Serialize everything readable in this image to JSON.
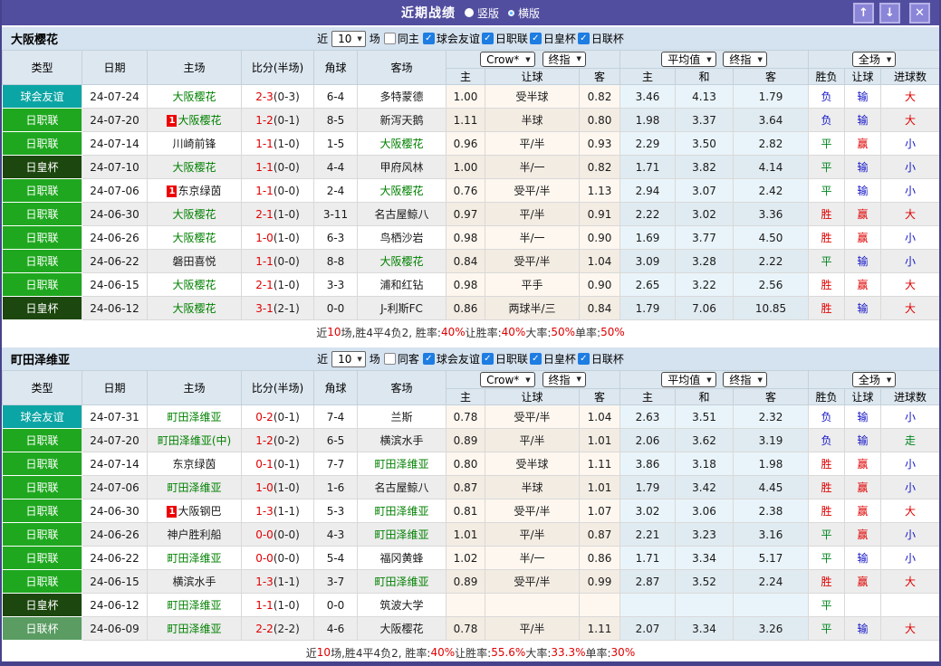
{
  "titlebar": {
    "title": "近期战绩",
    "radio_selected": "竖版",
    "radio_unselected": "横版",
    "up_icon": "↑",
    "down_icon": "↓",
    "close_icon": "✕"
  },
  "colors": {
    "titlebar_purple": "#524e9f",
    "friendly_teal": "#0ca5a5",
    "jleague_green": "#1fa81f",
    "emperor_cup_dark_green": "#1c470e",
    "league_cup_green": "#5a9c62",
    "focus_team_green": "#008000",
    "win_red": "#e00000",
    "draw_green": "#00851f",
    "lose_blue": "#1515c8",
    "checkbox_blue": "#1d7de2"
  },
  "table_header": {
    "col_type": "类型",
    "col_date": "日期",
    "col_home": "主场",
    "col_score": "比分(半场)",
    "col_corner": "角球",
    "col_away": "客场",
    "crow_select": "Crow*",
    "final_select": "终指",
    "avg_select": "平均值",
    "final_select2": "终指",
    "full_select": "全场",
    "sub_home": "主",
    "sub_handicap": "让球",
    "sub_away": "客",
    "sub_draw": "和",
    "sub_wdl": "胜负",
    "sub_handicap2": "让球",
    "sub_goals": "进球数"
  },
  "filter_labels": {
    "near": "近",
    "count": "10",
    "matches": "场"
  },
  "sections": [
    {
      "team": "大阪樱花",
      "same_option": "同主",
      "leagues": [
        "球会友谊",
        "日职联",
        "日皇杯",
        "日联杯"
      ],
      "rows": [
        {
          "type": "球会友谊",
          "type_key": "friendly",
          "date": "24-07-24",
          "home": "大阪樱花",
          "home_focus": true,
          "home_badge": false,
          "score": "2-3",
          "half": "(0-3)",
          "corner": "6-4",
          "away": "多特蒙德",
          "away_focus": false,
          "away_badge": false,
          "crow": [
            "1.00",
            "受半球",
            "0.82"
          ],
          "avg": [
            "3.46",
            "4.13",
            "1.79"
          ],
          "res": [
            "负",
            "输",
            "大"
          ]
        },
        {
          "type": "日职联",
          "type_key": "jleague",
          "date": "24-07-20",
          "home": "大阪樱花",
          "home_focus": true,
          "home_badge": true,
          "score": "1-2",
          "half": "(0-1)",
          "corner": "8-5",
          "away": "新泻天鹅",
          "away_focus": false,
          "away_badge": false,
          "crow": [
            "1.11",
            "半球",
            "0.80"
          ],
          "avg": [
            "1.98",
            "3.37",
            "3.64"
          ],
          "res": [
            "负",
            "输",
            "大"
          ]
        },
        {
          "type": "日职联",
          "type_key": "jleague",
          "date": "24-07-14",
          "home": "川崎前锋",
          "home_focus": false,
          "home_badge": false,
          "score": "1-1",
          "half": "(1-0)",
          "corner": "1-5",
          "away": "大阪樱花",
          "away_focus": true,
          "away_badge": false,
          "crow": [
            "0.96",
            "平/半",
            "0.93"
          ],
          "avg": [
            "2.29",
            "3.50",
            "2.82"
          ],
          "res": [
            "平",
            "赢",
            "小"
          ]
        },
        {
          "type": "日皇杯",
          "type_key": "emperor",
          "date": "24-07-10",
          "home": "大阪樱花",
          "home_focus": true,
          "home_badge": false,
          "score": "1-1",
          "half": "(0-0)",
          "corner": "4-4",
          "away": "甲府风林",
          "away_focus": false,
          "away_badge": false,
          "crow": [
            "1.00",
            "半/一",
            "0.82"
          ],
          "avg": [
            "1.71",
            "3.82",
            "4.14"
          ],
          "res": [
            "平",
            "输",
            "小"
          ]
        },
        {
          "type": "日职联",
          "type_key": "jleague",
          "date": "24-07-06",
          "home": "东京绿茵",
          "home_focus": false,
          "home_badge": true,
          "score": "1-1",
          "half": "(0-0)",
          "corner": "2-4",
          "away": "大阪樱花",
          "away_focus": true,
          "away_badge": false,
          "crow": [
            "0.76",
            "受平/半",
            "1.13"
          ],
          "avg": [
            "2.94",
            "3.07",
            "2.42"
          ],
          "res": [
            "平",
            "输",
            "小"
          ]
        },
        {
          "type": "日职联",
          "type_key": "jleague",
          "date": "24-06-30",
          "home": "大阪樱花",
          "home_focus": true,
          "home_badge": false,
          "score": "2-1",
          "half": "(1-0)",
          "corner": "3-11",
          "away": "名古屋鲸八",
          "away_focus": false,
          "away_badge": false,
          "crow": [
            "0.97",
            "平/半",
            "0.91"
          ],
          "avg": [
            "2.22",
            "3.02",
            "3.36"
          ],
          "res": [
            "胜",
            "赢",
            "大"
          ]
        },
        {
          "type": "日职联",
          "type_key": "jleague",
          "date": "24-06-26",
          "home": "大阪樱花",
          "home_focus": true,
          "home_badge": false,
          "score": "1-0",
          "half": "(1-0)",
          "corner": "6-3",
          "away": "鸟栖沙岩",
          "away_focus": false,
          "away_badge": false,
          "crow": [
            "0.98",
            "半/一",
            "0.90"
          ],
          "avg": [
            "1.69",
            "3.77",
            "4.50"
          ],
          "res": [
            "胜",
            "赢",
            "小"
          ]
        },
        {
          "type": "日职联",
          "type_key": "jleague",
          "date": "24-06-22",
          "home": "磐田喜悦",
          "home_focus": false,
          "home_badge": false,
          "score": "1-1",
          "half": "(0-0)",
          "corner": "8-8",
          "away": "大阪樱花",
          "away_focus": true,
          "away_badge": false,
          "crow": [
            "0.84",
            "受平/半",
            "1.04"
          ],
          "avg": [
            "3.09",
            "3.28",
            "2.22"
          ],
          "res": [
            "平",
            "输",
            "小"
          ]
        },
        {
          "type": "日职联",
          "type_key": "jleague",
          "date": "24-06-15",
          "home": "大阪樱花",
          "home_focus": true,
          "home_badge": false,
          "score": "2-1",
          "half": "(1-0)",
          "corner": "3-3",
          "away": "浦和红钻",
          "away_focus": false,
          "away_badge": false,
          "crow": [
            "0.98",
            "平手",
            "0.90"
          ],
          "avg": [
            "2.65",
            "3.22",
            "2.56"
          ],
          "res": [
            "胜",
            "赢",
            "大"
          ]
        },
        {
          "type": "日皇杯",
          "type_key": "emperor",
          "date": "24-06-12",
          "home": "大阪樱花",
          "home_focus": true,
          "home_badge": false,
          "score": "3-1",
          "half": "(2-1)",
          "corner": "0-0",
          "away": "J-利斯FC",
          "away_focus": false,
          "away_badge": false,
          "crow": [
            "0.86",
            "两球半/三",
            "0.84"
          ],
          "avg": [
            "1.79",
            "7.06",
            "10.85"
          ],
          "res": [
            "胜",
            "输",
            "大"
          ]
        }
      ],
      "summary": [
        {
          "t": "近"
        },
        {
          "t": "10",
          "red": true
        },
        {
          "t": "场,胜4平4负2, 胜率:"
        },
        {
          "t": "40%",
          "red": true
        },
        {
          "t": " 让胜率:"
        },
        {
          "t": "40%",
          "red": true
        },
        {
          "t": " 大率:"
        },
        {
          "t": "50%",
          "red": true
        },
        {
          "t": " 单率:"
        },
        {
          "t": "50%",
          "red": true
        }
      ]
    },
    {
      "team": "町田泽维亚",
      "same_option": "同客",
      "leagues": [
        "球会友谊",
        "日职联",
        "日皇杯",
        "日联杯"
      ],
      "rows": [
        {
          "type": "球会友谊",
          "type_key": "friendly",
          "date": "24-07-31",
          "home": "町田泽维亚",
          "home_focus": true,
          "home_badge": false,
          "score": "0-2",
          "half": "(0-1)",
          "corner": "7-4",
          "away": "兰斯",
          "away_focus": false,
          "away_badge": false,
          "crow": [
            "0.78",
            "受平/半",
            "1.04"
          ],
          "avg": [
            "2.63",
            "3.51",
            "2.32"
          ],
          "res": [
            "负",
            "输",
            "小"
          ]
        },
        {
          "type": "日职联",
          "type_key": "jleague",
          "date": "24-07-20",
          "home": "町田泽维亚(中)",
          "home_focus": true,
          "home_badge": false,
          "score": "1-2",
          "half": "(0-2)",
          "corner": "6-5",
          "away": "横滨水手",
          "away_focus": false,
          "away_badge": false,
          "crow": [
            "0.89",
            "平/半",
            "1.01"
          ],
          "avg": [
            "2.06",
            "3.62",
            "3.19"
          ],
          "res": [
            "负",
            "输",
            "走"
          ]
        },
        {
          "type": "日职联",
          "type_key": "jleague",
          "date": "24-07-14",
          "home": "东京绿茵",
          "home_focus": false,
          "home_badge": false,
          "score": "0-1",
          "half": "(0-1)",
          "corner": "7-7",
          "away": "町田泽维亚",
          "away_focus": true,
          "away_badge": false,
          "crow": [
            "0.80",
            "受半球",
            "1.11"
          ],
          "avg": [
            "3.86",
            "3.18",
            "1.98"
          ],
          "res": [
            "胜",
            "赢",
            "小"
          ]
        },
        {
          "type": "日职联",
          "type_key": "jleague",
          "date": "24-07-06",
          "home": "町田泽维亚",
          "home_focus": true,
          "home_badge": false,
          "score": "1-0",
          "half": "(1-0)",
          "corner": "1-6",
          "away": "名古屋鲸八",
          "away_focus": false,
          "away_badge": false,
          "crow": [
            "0.87",
            "半球",
            "1.01"
          ],
          "avg": [
            "1.79",
            "3.42",
            "4.45"
          ],
          "res": [
            "胜",
            "赢",
            "小"
          ]
        },
        {
          "type": "日职联",
          "type_key": "jleague",
          "date": "24-06-30",
          "home": "大阪钢巴",
          "home_focus": false,
          "home_badge": true,
          "score": "1-3",
          "half": "(1-1)",
          "corner": "5-3",
          "away": "町田泽维亚",
          "away_focus": true,
          "away_badge": false,
          "crow": [
            "0.81",
            "受平/半",
            "1.07"
          ],
          "avg": [
            "3.02",
            "3.06",
            "2.38"
          ],
          "res": [
            "胜",
            "赢",
            "大"
          ]
        },
        {
          "type": "日职联",
          "type_key": "jleague",
          "date": "24-06-26",
          "home": "神户胜利船",
          "home_focus": false,
          "home_badge": false,
          "score": "0-0",
          "half": "(0-0)",
          "corner": "4-3",
          "away": "町田泽维亚",
          "away_focus": true,
          "away_badge": false,
          "crow": [
            "1.01",
            "平/半",
            "0.87"
          ],
          "avg": [
            "2.21",
            "3.23",
            "3.16"
          ],
          "res": [
            "平",
            "赢",
            "小"
          ]
        },
        {
          "type": "日职联",
          "type_key": "jleague",
          "date": "24-06-22",
          "home": "町田泽维亚",
          "home_focus": true,
          "home_badge": false,
          "score": "0-0",
          "half": "(0-0)",
          "corner": "5-4",
          "away": "福冈黄蜂",
          "away_focus": false,
          "away_badge": false,
          "crow": [
            "1.02",
            "半/一",
            "0.86"
          ],
          "avg": [
            "1.71",
            "3.34",
            "5.17"
          ],
          "res": [
            "平",
            "输",
            "小"
          ]
        },
        {
          "type": "日职联",
          "type_key": "jleague",
          "date": "24-06-15",
          "home": "横滨水手",
          "home_focus": false,
          "home_badge": false,
          "score": "1-3",
          "half": "(1-1)",
          "corner": "3-7",
          "away": "町田泽维亚",
          "away_focus": true,
          "away_badge": false,
          "crow": [
            "0.89",
            "受平/半",
            "0.99"
          ],
          "avg": [
            "2.87",
            "3.52",
            "2.24"
          ],
          "res": [
            "胜",
            "赢",
            "大"
          ]
        },
        {
          "type": "日皇杯",
          "type_key": "emperor",
          "date": "24-06-12",
          "home": "町田泽维亚",
          "home_focus": true,
          "home_badge": false,
          "score": "1-1",
          "half": "(1-0)",
          "corner": "0-0",
          "away": "筑波大学",
          "away_focus": false,
          "away_badge": false,
          "crow": [
            "",
            "",
            ""
          ],
          "avg": [
            "",
            "",
            ""
          ],
          "res": [
            "平",
            "",
            ""
          ]
        },
        {
          "type": "日联杯",
          "type_key": "lcup",
          "date": "24-06-09",
          "home": "町田泽维亚",
          "home_focus": true,
          "home_badge": false,
          "score": "2-2",
          "half": "(2-2)",
          "corner": "4-6",
          "away": "大阪樱花",
          "away_focus": false,
          "away_badge": false,
          "crow": [
            "0.78",
            "平/半",
            "1.11"
          ],
          "avg": [
            "2.07",
            "3.34",
            "3.26"
          ],
          "res": [
            "平",
            "输",
            "大"
          ]
        }
      ],
      "summary": [
        {
          "t": "近"
        },
        {
          "t": "10",
          "red": true
        },
        {
          "t": "场,胜4平4负2, 胜率:"
        },
        {
          "t": "40%",
          "red": true
        },
        {
          "t": " 让胜率:"
        },
        {
          "t": "55.6%",
          "red": true
        },
        {
          "t": " 大率:"
        },
        {
          "t": "33.3%",
          "red": true
        },
        {
          "t": " 单率:"
        },
        {
          "t": "30%",
          "red": true
        }
      ]
    }
  ]
}
